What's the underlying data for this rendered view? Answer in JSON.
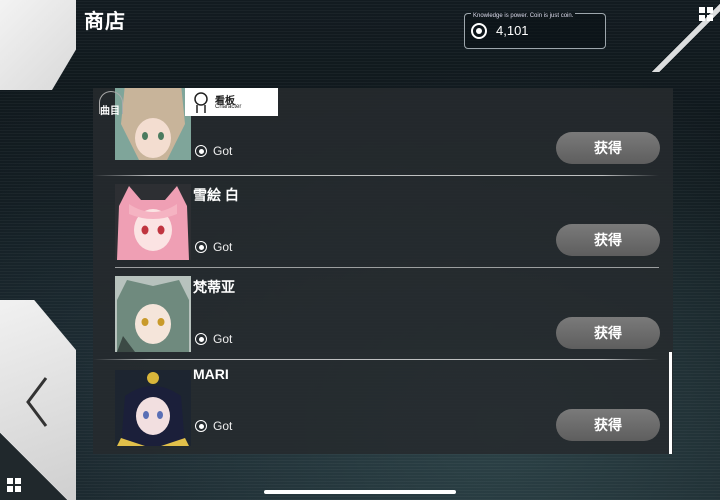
{
  "header": {
    "title": "商店",
    "coin_motto": "Knowledge is power. Coin is just coin.",
    "coin_value": "4,101"
  },
  "tabs": [
    {
      "label": "曲目",
      "sub": ""
    },
    {
      "label": "看板",
      "sub": "Character"
    }
  ],
  "items": [
    {
      "name": "",
      "status": "Got",
      "button": "获得"
    },
    {
      "name": "雪絵 白",
      "status": "Got",
      "button": "获得"
    },
    {
      "name": "梵蒂亚",
      "status": "Got",
      "button": "获得"
    },
    {
      "name": "MARI",
      "status": "Got",
      "button": "获得"
    }
  ],
  "icons": {
    "menu": "grid-icon",
    "back": "chevron-left-icon",
    "coin": "coin-icon",
    "status": "radio-icon",
    "character_tab": "person-icon"
  },
  "colors": {
    "button": "#6b6b6b",
    "panel": "#26292c",
    "accent": "#ffffff"
  }
}
